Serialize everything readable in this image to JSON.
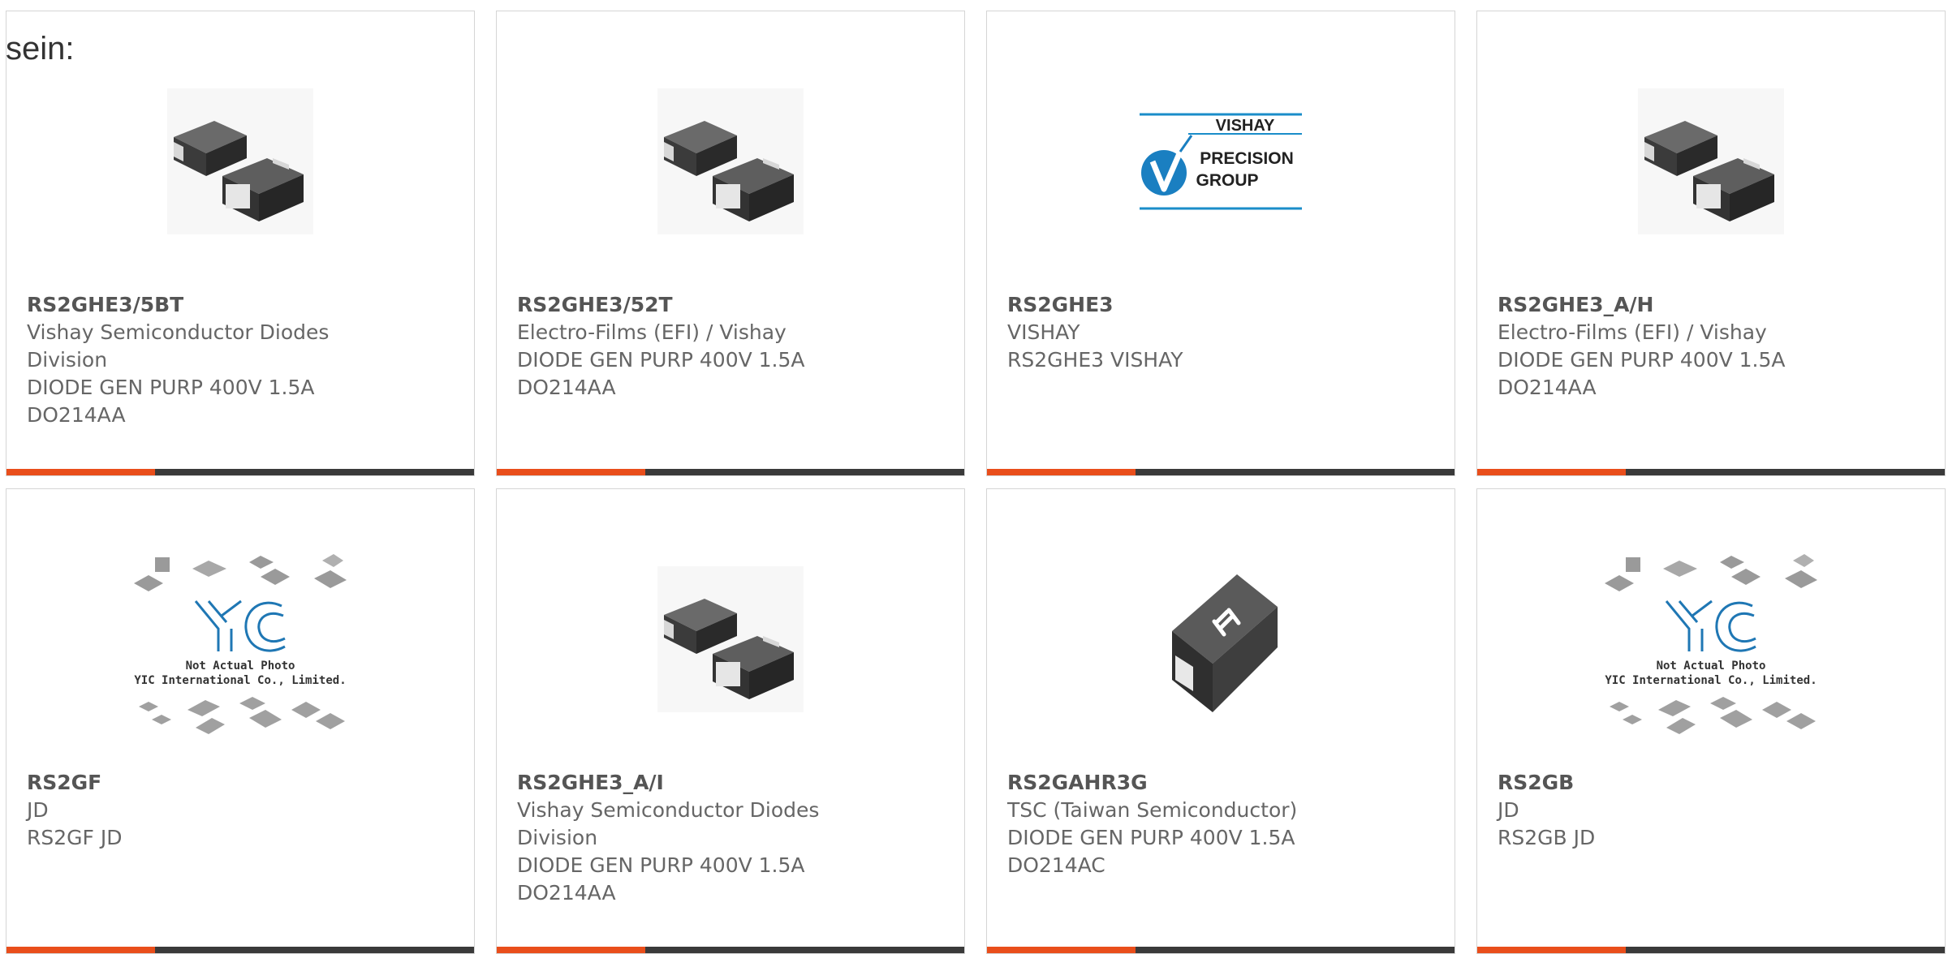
{
  "intro_text": "sein:",
  "colors": {
    "accent": "#e94e1b",
    "bar_dark": "#3a3a3a",
    "text": "#666666",
    "border": "#d5d5d5"
  },
  "products": [
    {
      "part": "RS2GHE3/5BT",
      "manufacturer": "Vishay Semiconductor Diodes\nDivision",
      "description": "DIODE GEN PURP 400V 1.5A\nDO214AA",
      "image": "smd-diode-pair"
    },
    {
      "part": "RS2GHE3/52T",
      "manufacturer": "Electro-Films (EFI) / Vishay",
      "description": "DIODE GEN PURP 400V 1.5A\nDO214AA",
      "image": "smd-diode-pair"
    },
    {
      "part": "RS2GHE3",
      "manufacturer": "VISHAY",
      "description": "RS2GHE3 VISHAY",
      "image": "vishay-logo",
      "logo_text": [
        "VISHAY",
        "PRECISION",
        "GROUP"
      ]
    },
    {
      "part": "RS2GHE3_A/H",
      "manufacturer": "Electro-Films (EFI) / Vishay",
      "description": "DIODE GEN PURP 400V 1.5A\nDO214AA",
      "image": "smd-diode-pair"
    },
    {
      "part": "RS2GF",
      "manufacturer": "JD",
      "description": "RS2GF JD",
      "image": "yic-placeholder",
      "logo_text": [
        "Not Actual Photo",
        "YIC International Co., Limited."
      ]
    },
    {
      "part": "RS2GHE3_A/I",
      "manufacturer": "Vishay Semiconductor Diodes\nDivision",
      "description": "DIODE GEN PURP 400V 1.5A\nDO214AA",
      "image": "smd-diode-pair"
    },
    {
      "part": "RS2GAHR3G",
      "manufacturer": "TSC (Taiwan Semiconductor)",
      "description": "DIODE GEN PURP 400V 1.5A\nDO214AC",
      "image": "tsc-diode"
    },
    {
      "part": "RS2GB",
      "manufacturer": "JD",
      "description": "RS2GB JD",
      "image": "yic-placeholder",
      "logo_text": [
        "Not Actual Photo",
        "YIC International Co., Limited."
      ]
    }
  ]
}
